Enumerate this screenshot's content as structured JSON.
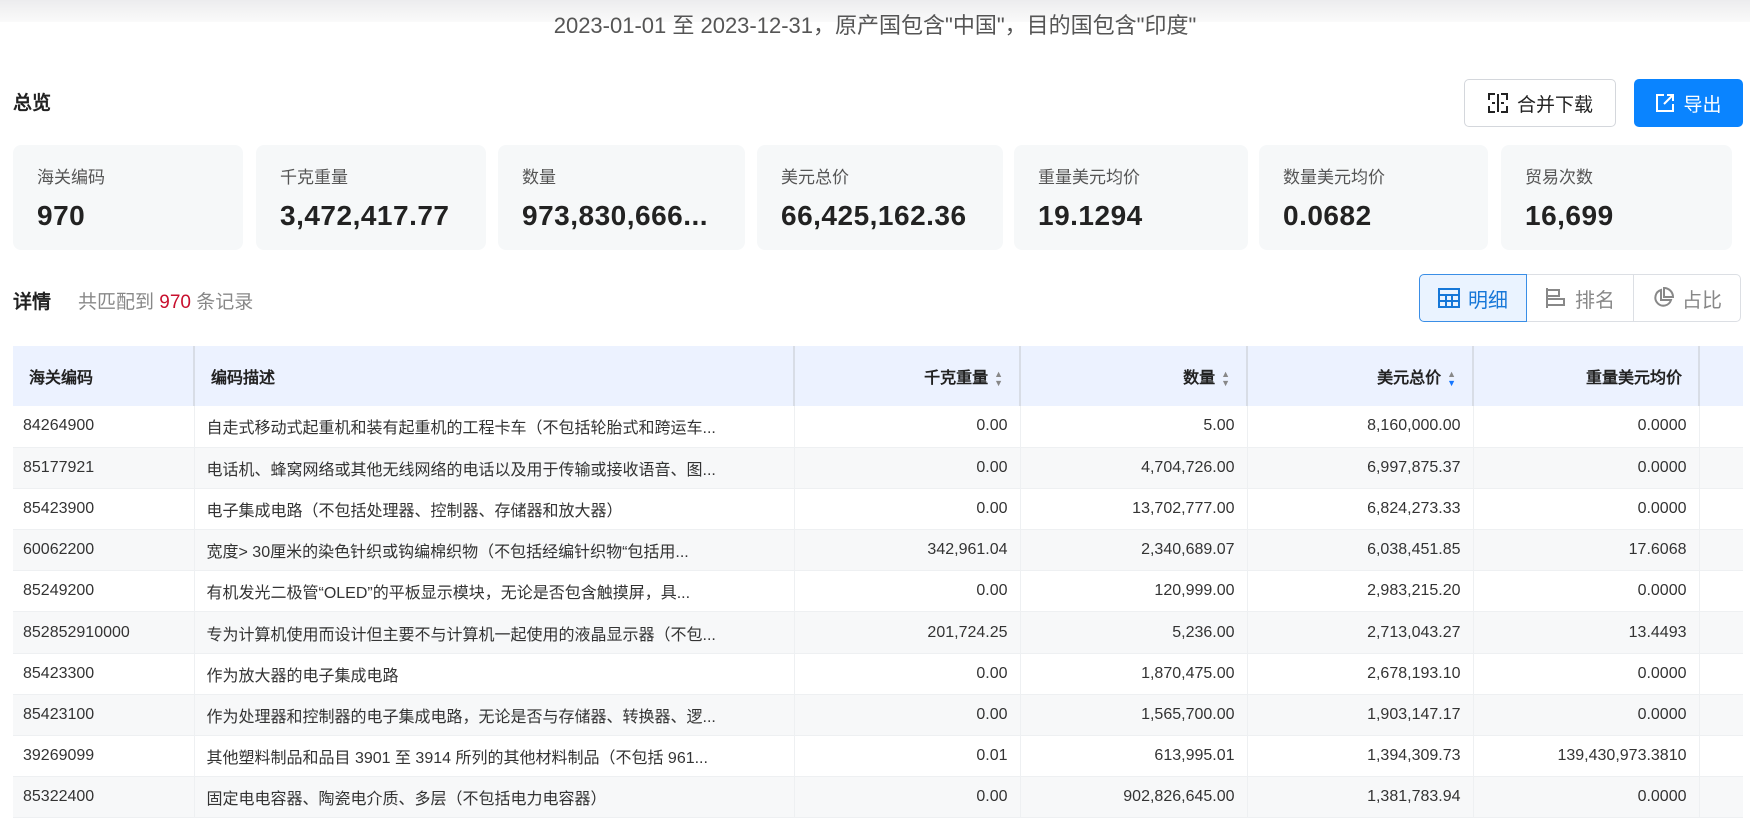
{
  "header": {
    "title": "2023-01-01 至 2023-12-31，原产国包含\"中国\"，目的国包含\"印度\""
  },
  "overview": {
    "title": "总览",
    "merge_label": "合并下载",
    "export_label": "导出",
    "accent": "#0a84ff",
    "cards": [
      {
        "label": "海关编码",
        "value": "970"
      },
      {
        "label": "千克重量",
        "value": "3,472,417.77"
      },
      {
        "label": "数量",
        "value": "973,830,666..."
      },
      {
        "label": "美元总价",
        "value": "66,425,162.36"
      },
      {
        "label": "重量美元均价",
        "value": "19.1294"
      },
      {
        "label": "数量美元均价",
        "value": "0.0682"
      },
      {
        "label": "贸易次数",
        "value": "16,699"
      }
    ]
  },
  "details": {
    "title": "详情",
    "prefix": "共匹配到",
    "count": "970",
    "suffix": "条记录",
    "views": [
      {
        "label": "明细",
        "icon": "table-icon",
        "active": true
      },
      {
        "label": "排名",
        "icon": "bar-rank-icon"
      },
      {
        "label": "占比",
        "icon": "pie-icon"
      }
    ]
  },
  "table": {
    "columns": [
      {
        "label": "海关编码"
      },
      {
        "label": "编码描述"
      },
      {
        "label": "千克重量",
        "sort": "none"
      },
      {
        "label": "数量",
        "sort": "none"
      },
      {
        "label": "美元总价",
        "sort": "desc"
      },
      {
        "label": "重量美元均价"
      }
    ],
    "rows": [
      [
        "84264900",
        "自走式移动式起重机和装有起重机的工程卡车（不包括轮胎式和跨运车...",
        "0.00",
        "5.00",
        "8,160,000.00",
        "0.0000"
      ],
      [
        "85177921",
        "电话机、蜂窝网络或其他无线网络的电话以及用于传输或接收语音、图...",
        "0.00",
        "4,704,726.00",
        "6,997,875.37",
        "0.0000"
      ],
      [
        "85423900",
        "电子集成电路（不包括处理器、控制器、存储器和放大器）",
        "0.00",
        "13,702,777.00",
        "6,824,273.33",
        "0.0000"
      ],
      [
        "60062200",
        "宽度> 30厘米的染色针织或钩编棉织物（不包括经编针织物“包括用...",
        "342,961.04",
        "2,340,689.07",
        "6,038,451.85",
        "17.6068"
      ],
      [
        "85249200",
        "有机发光二极管“OLED”的平板显示模块，无论是否包含触摸屏，具...",
        "0.00",
        "120,999.00",
        "2,983,215.20",
        "0.0000"
      ],
      [
        "852852910000",
        "专为计算机使用而设计但主要不与计算机一起使用的液晶显示器（不包...",
        "201,724.25",
        "5,236.00",
        "2,713,043.27",
        "13.4493"
      ],
      [
        "85423300",
        "作为放大器的电子集成电路",
        "0.00",
        "1,870,475.00",
        "2,678,193.10",
        "0.0000"
      ],
      [
        "85423100",
        "作为处理器和控制器的电子集成电路，无论是否与存储器、转换器、逻...",
        "0.00",
        "1,565,700.00",
        "1,903,147.17",
        "0.0000"
      ],
      [
        "39269099",
        "其他塑料制品和品目 3901 至 3914 所列的其他材料制品（不包括 961...",
        "0.01",
        "613,995.01",
        "1,394,309.73",
        "139,430,973.3810"
      ],
      [
        "85322400",
        "固定电电容器、陶瓷电介质、多层（不包括电力电容器）",
        "0.00",
        "902,826,645.00",
        "1,381,783.94",
        "0.0000"
      ]
    ]
  }
}
